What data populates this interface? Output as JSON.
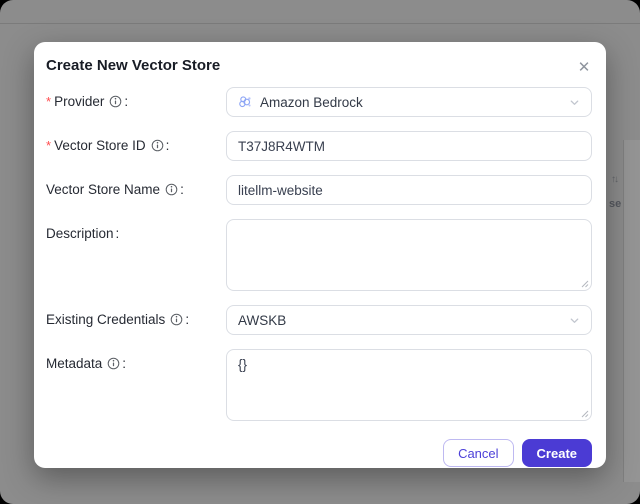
{
  "background": {
    "sort_icon": "↑↓",
    "partial_text": "se"
  },
  "modal": {
    "title": "Create New Vector Store",
    "close_glyph": "✕",
    "required_marker": "*",
    "colon": ":",
    "fields": {
      "provider": {
        "label": "Provider",
        "required": true,
        "value": "Amazon Bedrock"
      },
      "vector_store_id": {
        "label": "Vector Store ID",
        "required": true,
        "value": "T37J8R4WTM"
      },
      "vector_store_name": {
        "label": "Vector Store Name",
        "required": false,
        "value": "litellm-website"
      },
      "description": {
        "label": "Description",
        "required": false,
        "value": ""
      },
      "existing_credentials": {
        "label": "Existing Credentials",
        "required": false,
        "value": "AWSKB"
      },
      "metadata": {
        "label": "Metadata",
        "required": false,
        "value": "{}"
      }
    },
    "footer": {
      "cancel_label": "Cancel",
      "create_label": "Create"
    }
  },
  "colors": {
    "accent": "#4b3bd4",
    "required": "#ff4d4f",
    "overlay": "#8c8c8c"
  }
}
